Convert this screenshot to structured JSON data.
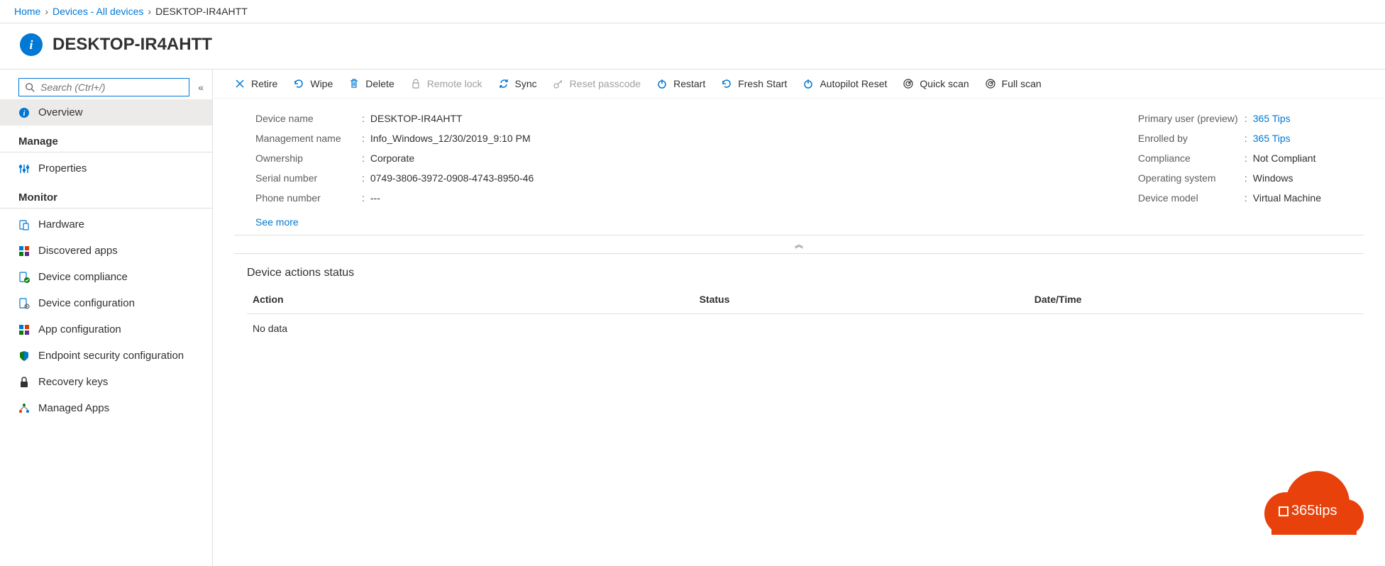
{
  "breadcrumb": {
    "home": "Home",
    "devices": "Devices - All devices",
    "current": "DESKTOP-IR4AHTT"
  },
  "header": {
    "title": "DESKTOP-IR4AHTT"
  },
  "sidebar": {
    "search_placeholder": "Search (Ctrl+/)",
    "overview": "Overview",
    "manage_label": "Manage",
    "properties": "Properties",
    "monitor_label": "Monitor",
    "hardware": "Hardware",
    "discovered_apps": "Discovered apps",
    "device_compliance": "Device compliance",
    "device_configuration": "Device configuration",
    "app_configuration": "App configuration",
    "endpoint_security": "Endpoint security configuration",
    "recovery_keys": "Recovery keys",
    "managed_apps": "Managed Apps"
  },
  "toolbar": {
    "retire": "Retire",
    "wipe": "Wipe",
    "delete": "Delete",
    "remote_lock": "Remote lock",
    "sync": "Sync",
    "reset_passcode": "Reset passcode",
    "restart": "Restart",
    "fresh_start": "Fresh Start",
    "autopilot_reset": "Autopilot Reset",
    "quick_scan": "Quick scan",
    "full_scan": "Full scan"
  },
  "details": {
    "left": {
      "device_name_label": "Device name",
      "device_name": "DESKTOP-IR4AHTT",
      "management_name_label": "Management name",
      "management_name": "Info_Windows_12/30/2019_9:10 PM",
      "ownership_label": "Ownership",
      "ownership": "Corporate",
      "serial_label": "Serial number",
      "serial": "0749-3806-3972-0908-4743-8950-46",
      "phone_label": "Phone number",
      "phone": "---"
    },
    "right": {
      "primary_user_label": "Primary user (preview)",
      "primary_user": "365 Tips",
      "enrolled_by_label": "Enrolled by",
      "enrolled_by": "365 Tips",
      "compliance_label": "Compliance",
      "compliance": "Not Compliant",
      "os_label": "Operating system",
      "os": "Windows",
      "model_label": "Device model",
      "model": "Virtual Machine"
    },
    "see_more": "See more"
  },
  "actions": {
    "title": "Device actions status",
    "col_action": "Action",
    "col_status": "Status",
    "col_date": "Date/Time",
    "no_data": "No data"
  },
  "logo": {
    "text": "365tips"
  }
}
